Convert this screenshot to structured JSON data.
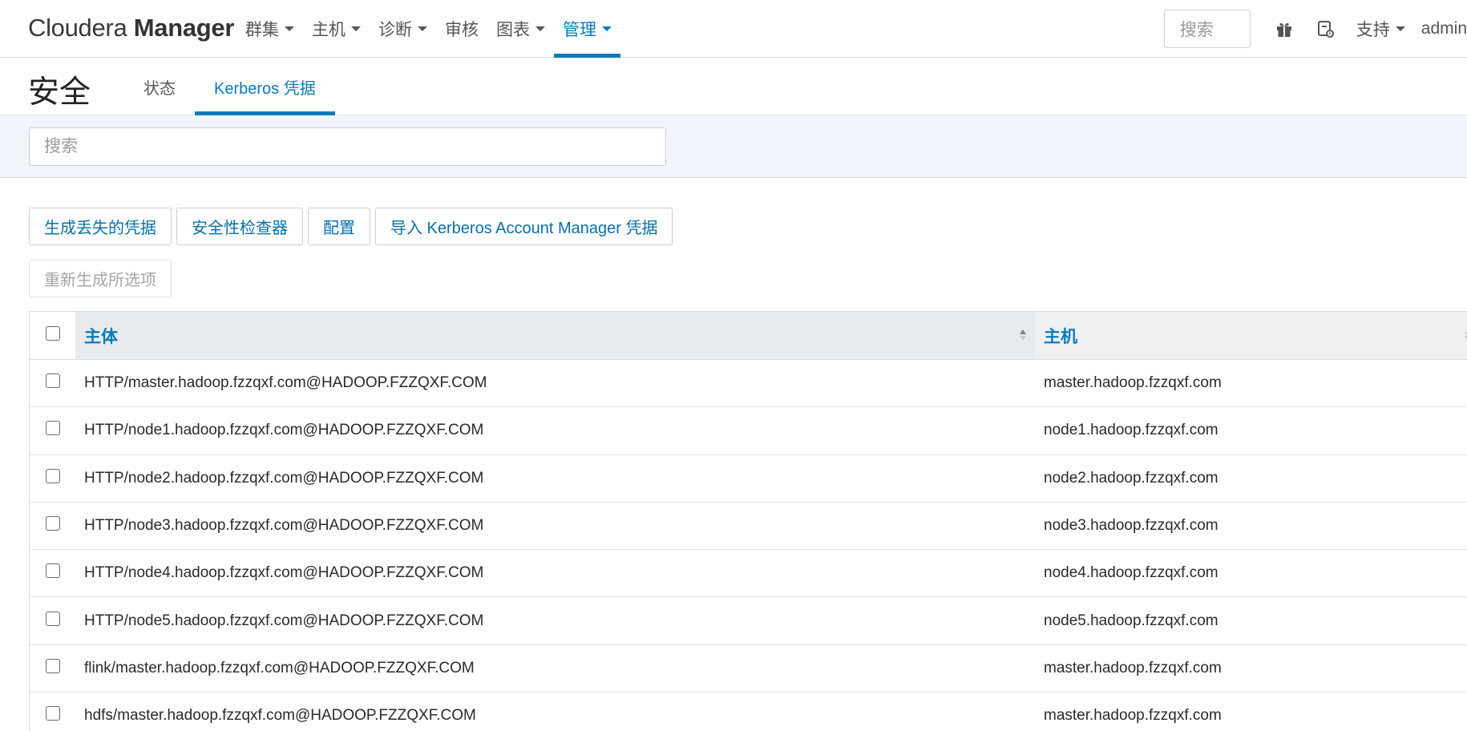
{
  "navbar": {
    "brand_light": "Cloudera",
    "brand_bold": "Manager",
    "items": [
      {
        "label": "群集",
        "dropdown": true
      },
      {
        "label": "主机",
        "dropdown": true
      },
      {
        "label": "诊断",
        "dropdown": true
      },
      {
        "label": "审核",
        "dropdown": false
      },
      {
        "label": "图表",
        "dropdown": true
      },
      {
        "label": "管理",
        "dropdown": true,
        "active": true
      }
    ],
    "search_placeholder": "搜索",
    "support_label": "支持",
    "user_label": "admin",
    "accent_color": "#0a7bb8"
  },
  "page": {
    "title": "安全",
    "tabs": [
      {
        "label": "状态",
        "active": false
      },
      {
        "label": "Kerberos 凭据",
        "active": true
      }
    ]
  },
  "filter": {
    "search_placeholder": "搜索"
  },
  "actions": {
    "generate_missing": "生成丢失的凭据",
    "security_inspector": "安全性检查器",
    "configure": "配置",
    "import_kerberos": "导入 Kerberos Account Manager 凭据",
    "regenerate_selected": "重新生成所选项"
  },
  "table": {
    "columns": {
      "principal": "主体",
      "host": "主机"
    },
    "rows": [
      {
        "principal": "HTTP/master.hadoop.fzzqxf.com@HADOOP.FZZQXF.COM",
        "host": "master.hadoop.fzzqxf.com"
      },
      {
        "principal": "HTTP/node1.hadoop.fzzqxf.com@HADOOP.FZZQXF.COM",
        "host": "node1.hadoop.fzzqxf.com"
      },
      {
        "principal": "HTTP/node2.hadoop.fzzqxf.com@HADOOP.FZZQXF.COM",
        "host": "node2.hadoop.fzzqxf.com"
      },
      {
        "principal": "HTTP/node3.hadoop.fzzqxf.com@HADOOP.FZZQXF.COM",
        "host": "node3.hadoop.fzzqxf.com"
      },
      {
        "principal": "HTTP/node4.hadoop.fzzqxf.com@HADOOP.FZZQXF.COM",
        "host": "node4.hadoop.fzzqxf.com"
      },
      {
        "principal": "HTTP/node5.hadoop.fzzqxf.com@HADOOP.FZZQXF.COM",
        "host": "node5.hadoop.fzzqxf.com"
      },
      {
        "principal": "flink/master.hadoop.fzzqxf.com@HADOOP.FZZQXF.COM",
        "host": "master.hadoop.fzzqxf.com"
      },
      {
        "principal": "hdfs/master.hadoop.fzzqxf.com@HADOOP.FZZQXF.COM",
        "host": "master.hadoop.fzzqxf.com"
      }
    ]
  },
  "icons": {
    "gift": "gift-icon",
    "tour": "guided-tour-icon",
    "sort": "sort-icon"
  }
}
